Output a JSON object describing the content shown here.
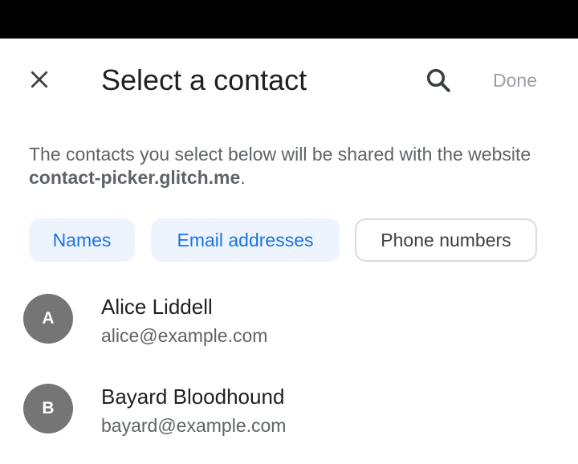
{
  "header": {
    "close_icon": "close-icon",
    "title": "Select a contact",
    "search_icon": "search-icon",
    "done_label": "Done",
    "done_color": "#9aa0a6"
  },
  "description": {
    "prefix": "The contacts you select below will be shared with the website ",
    "site": "contact-picker.glitch.me",
    "suffix": "."
  },
  "filters": [
    {
      "label": "Names",
      "selected": true
    },
    {
      "label": "Email addresses",
      "selected": true
    },
    {
      "label": "Phone numbers",
      "selected": false
    }
  ],
  "contacts": [
    {
      "initial": "A",
      "name": "Alice Liddell",
      "email": "alice@example.com"
    },
    {
      "initial": "B",
      "name": "Bayard Bloodhound",
      "email": "bayard@example.com"
    }
  ],
  "colors": {
    "accent": "#1a73e8",
    "chip_selected_bg": "#eef4fd",
    "avatar_bg": "#757575"
  }
}
